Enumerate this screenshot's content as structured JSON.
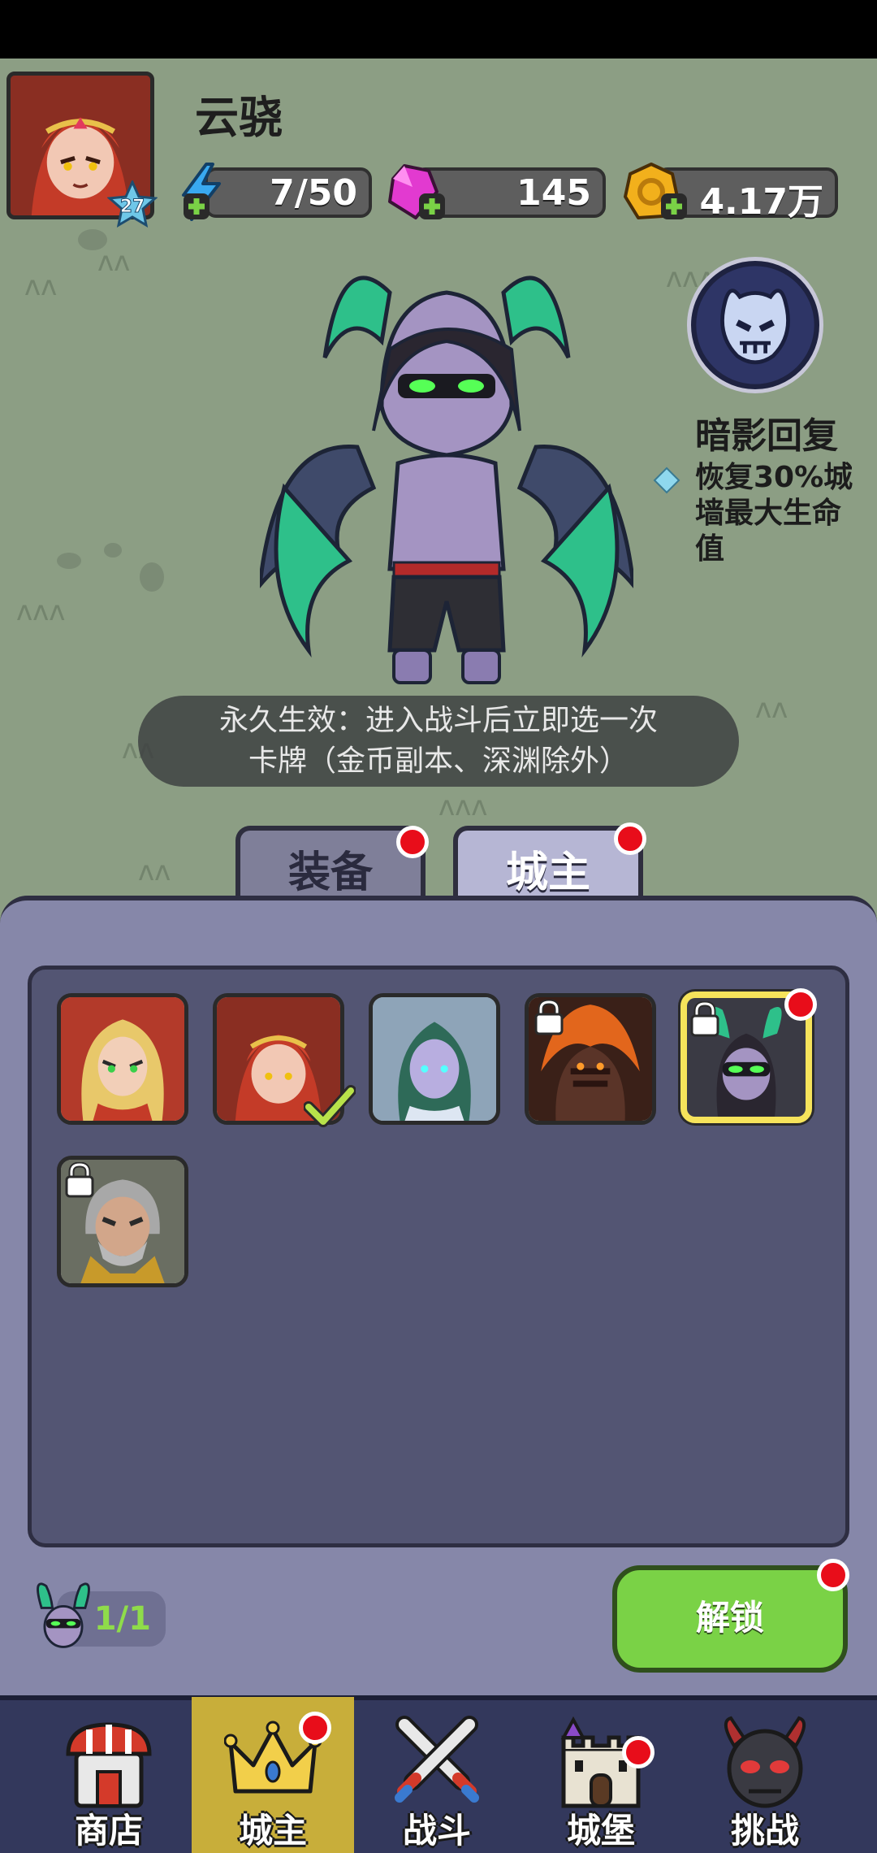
{
  "player": {
    "name": "云骁",
    "level": "27"
  },
  "resources": {
    "energy": "7/50",
    "gems": "145",
    "gold": "4.17万"
  },
  "skill": {
    "name": "暗影回复",
    "desc": "恢复30%城墙最大生命值"
  },
  "effect_text": [
    "永久生效：进入战斗后立即选一次",
    "卡牌（金币副本、深渊除外）"
  ],
  "tabs": [
    {
      "label": "装备"
    },
    {
      "label": "城主"
    }
  ],
  "roster": {
    "count": "1/1"
  },
  "unlock_button": "解锁",
  "nav": [
    {
      "label": "商店"
    },
    {
      "label": "城主"
    },
    {
      "label": "战斗"
    },
    {
      "label": "城堡"
    },
    {
      "label": "挑战"
    }
  ],
  "colors": {
    "accent_green": "#7ad246",
    "badge_red": "#e80d1a",
    "panel": "#8687a9",
    "nav_active": "#c8ae3a"
  }
}
